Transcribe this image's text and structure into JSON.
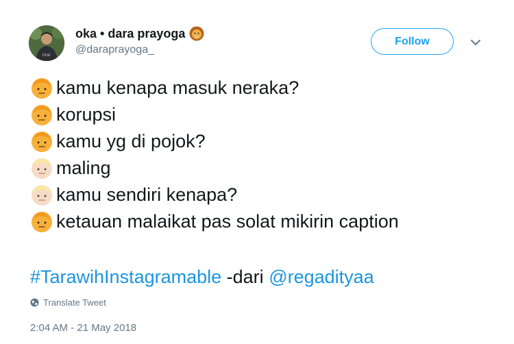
{
  "author": {
    "display_name": "oka • dara prayoga",
    "handle": "@daraprayoga_",
    "name_emoji": "lion-face-icon"
  },
  "follow_label": "Follow",
  "tweet_lines": [
    {
      "emoji": "face-icon-tone-medium",
      "text": "kamu kenapa masuk neraka?"
    },
    {
      "emoji": "face-icon-tone-medium",
      "text": "korupsi"
    },
    {
      "emoji": "face-icon-tone-medium",
      "text": "kamu yg di pojok?"
    },
    {
      "emoji": "face-icon-tone-light",
      "text": "maling"
    },
    {
      "emoji": "face-icon-tone-light",
      "text": "kamu sendiri kenapa?"
    },
    {
      "emoji": "face-icon-tone-medium",
      "text": "ketauan malaikat pas solat mikirin caption"
    }
  ],
  "hashtag": "#TarawihInstagramable",
  "hashtag_mid": " -dari ",
  "mention": "@regadityaa",
  "translate_label": "Translate Tweet",
  "timestamp": "2:04 AM - 21 May 2018",
  "colors": {
    "accent": "#1da1f2",
    "link": "#1b95e0",
    "secondary_text": "#657786",
    "skin_medium": "#f7b13a",
    "skin_light": "#f6dcc7"
  }
}
